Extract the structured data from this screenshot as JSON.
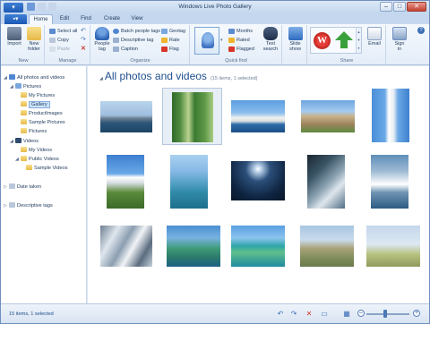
{
  "window": {
    "title": "Windows Live Photo Gallery"
  },
  "tabs": [
    "Home",
    "Edit",
    "Find",
    "Create",
    "View"
  ],
  "ribbon": {
    "new": {
      "import": "Import",
      "new_folder_1": "New",
      "new_folder_2": "folder",
      "label": "New"
    },
    "manage": {
      "select_all": "Select all",
      "copy": "Copy",
      "paste": "Paste",
      "label": "Manage"
    },
    "organize": {
      "people_tag_1": "People",
      "people_tag_2": "tag",
      "batch_people_tags": "Batch people tags",
      "descriptive_tag": "Descriptive tag",
      "caption": "Caption",
      "geotag": "Geotag",
      "rate": "Rate",
      "flag": "Flag",
      "label": "Organize"
    },
    "quickfind": {
      "months": "Months",
      "rated": "Rated",
      "flagged": "Flagged",
      "text_search_1": "Text",
      "text_search_2": "search",
      "label": "Quick find"
    },
    "slideshow": {
      "l1": "Slide",
      "l2": "show"
    },
    "share": {
      "email": "Email",
      "label": "Share"
    },
    "signin": {
      "l1": "Sign",
      "l2": "in"
    }
  },
  "nav": {
    "all": "All photos and videos",
    "pictures": "Pictures",
    "my_pictures": "My Pictures",
    "gallery": "Gallery",
    "product_images": "ProductImages",
    "sample_pictures": "Sample Pictures",
    "pictures2": "Pictures",
    "videos": "Videos",
    "my_videos": "My Videos",
    "public_videos": "Public Videos",
    "sample_videos": "Sample Videos",
    "date_taken": "Date taken",
    "descriptive_tags": "Descriptive tags"
  },
  "main": {
    "heading": "All photos and videos",
    "subheading": "(15 items, 1 selected)"
  },
  "status": {
    "text": "15 items, 1 selected"
  },
  "photos": [
    {
      "name": "city-skyline-photo"
    },
    {
      "name": "garden-trees-photo"
    },
    {
      "name": "opera-house-photo"
    },
    {
      "name": "cathedral-photo"
    },
    {
      "name": "lighthouse-photo"
    },
    {
      "name": "lighthouse-cliff-photo"
    },
    {
      "name": "boat-bay-photo"
    },
    {
      "name": "sunset-sea-photo"
    },
    {
      "name": "boat-deck-photo"
    },
    {
      "name": "ship-wake-photo"
    },
    {
      "name": "aerial-mountains-photo"
    },
    {
      "name": "plane-wing-photo"
    },
    {
      "name": "aerial-island-photo"
    },
    {
      "name": "plane-over-land-photo"
    },
    {
      "name": "plane-sky-photo"
    }
  ]
}
